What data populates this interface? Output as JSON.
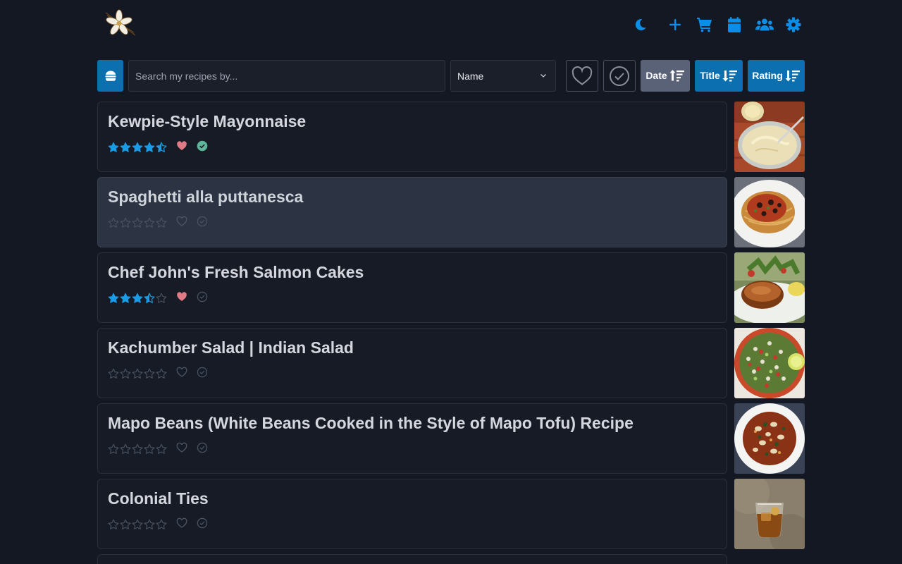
{
  "header": {
    "icons": [
      "logo-flower",
      "moon-icon",
      "plus-icon",
      "cart-icon",
      "calendar-icon",
      "users-icon",
      "gear-icon"
    ]
  },
  "toolbar": {
    "search_placeholder": "Search my recipes by...",
    "sort_field": "Name",
    "sort_buttons": [
      {
        "label": "Date",
        "active": false
      },
      {
        "label": "Title",
        "active": true
      },
      {
        "label": "Rating",
        "active": true
      }
    ]
  },
  "colors": {
    "accent": "#0b8ee8",
    "star_filled": "#1a9be6",
    "star_empty": "#4b5563",
    "heart_active": "#e07a85",
    "check_active": "#5fb49a",
    "background": "#141823"
  },
  "recipes": [
    {
      "title": "Kewpie-Style Mayonnaise",
      "rating": 4.5,
      "favorite": true,
      "made": true,
      "image": "mayonnaise"
    },
    {
      "title": "Spaghetti alla puttanesca",
      "rating": 0,
      "favorite": false,
      "made": false,
      "image": "spaghetti"
    },
    {
      "title": "Chef John's Fresh Salmon Cakes",
      "rating": 3.5,
      "favorite": true,
      "made": false,
      "image": "salmon-cake"
    },
    {
      "title": "Kachumber Salad | Indian Salad",
      "rating": 0,
      "favorite": false,
      "made": false,
      "image": "salad"
    },
    {
      "title": "Mapo Beans (White Beans Cooked in the Style of Mapo Tofu) Recipe",
      "rating": 0,
      "favorite": false,
      "made": false,
      "image": "mapo-beans"
    },
    {
      "title": "Colonial Ties",
      "rating": 0,
      "favorite": false,
      "made": false,
      "image": "cocktail"
    }
  ]
}
